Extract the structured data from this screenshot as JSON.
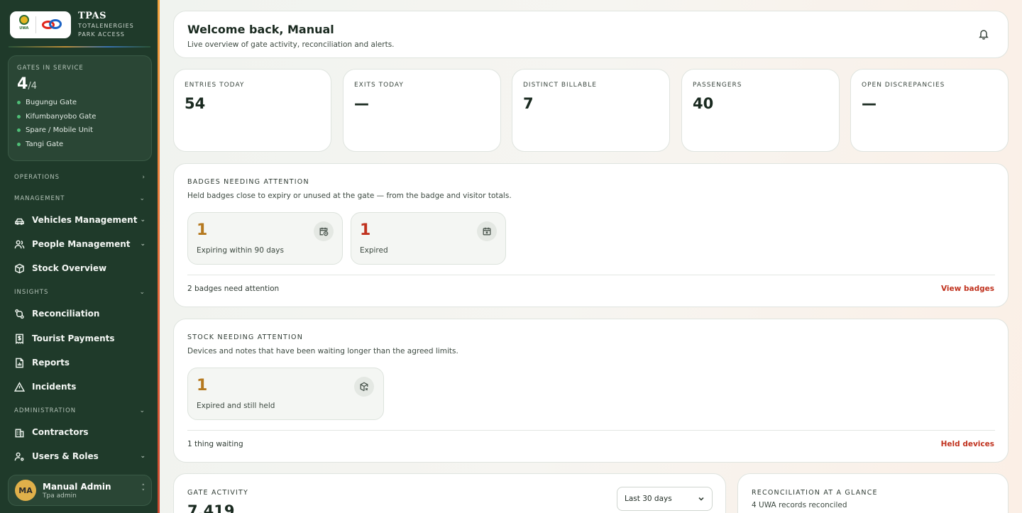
{
  "brand": {
    "uwa_text": "UWA",
    "title": "TPAS",
    "subtitle_line1": "TOTALENERGIES",
    "subtitle_line2": "PARK ACCESS"
  },
  "gates": {
    "label": "GATES IN SERVICE",
    "count": "4",
    "total": "/4",
    "items": [
      "Bugungu Gate",
      "Kifumbanyobo Gate",
      "Spare / Mobile Unit",
      "Tangi Gate"
    ]
  },
  "nav": {
    "operations": "OPERATIONS",
    "management": "MANAGEMENT",
    "vehicles": "Vehicles Management",
    "people": "People Management",
    "stock": "Stock Overview",
    "insights": "INSIGHTS",
    "reconciliation": "Reconciliation",
    "tourist_payments": "Tourist Payments",
    "reports": "Reports",
    "incidents": "Incidents",
    "administration": "ADMINISTRATION",
    "contractors": "Contractors",
    "users_roles": "Users & Roles"
  },
  "user": {
    "initials": "MA",
    "name": "Manual Admin",
    "role": "Tpa admin"
  },
  "welcome": {
    "title": "Welcome back, Manual",
    "subtitle": "Live overview of gate activity, reconciliation and alerts."
  },
  "stats": [
    {
      "label": "ENTRIES TODAY",
      "value": "54"
    },
    {
      "label": "EXITS TODAY",
      "value": "—"
    },
    {
      "label": "DISTINCT BILLABLE",
      "value": "7"
    },
    {
      "label": "PASSENGERS",
      "value": "40"
    },
    {
      "label": "OPEN DISCREPANCIES",
      "value": "—"
    }
  ],
  "badges": {
    "title": "BADGES NEEDING ATTENTION",
    "subtitle": "Held badges close to expiry or unused at the gate — from the badge and visitor totals.",
    "expiring_value": "1",
    "expiring_label": "Expiring within 90 days",
    "expired_value": "1",
    "expired_label": "Expired",
    "footer": "2 badges need attention",
    "link": "View badges"
  },
  "stock": {
    "title": "STOCK NEEDING ATTENTION",
    "subtitle": "Devices and notes that have been waiting longer than the agreed limits.",
    "held_value": "1",
    "held_label": "Expired and still held",
    "footer": "1 thing waiting",
    "link": "Held devices"
  },
  "gate_activity": {
    "title": "GATE ACTIVITY",
    "value": "7,419",
    "range": "Last 30 days"
  },
  "recon": {
    "title": "RECONCILIATION AT A GLANCE",
    "subtitle": "4 UWA records reconciled"
  },
  "colors": {
    "sidebar": "#1f3a2a",
    "accent_amber": "#b5791f",
    "accent_red": "#c0321e",
    "link": "#c0321e"
  }
}
